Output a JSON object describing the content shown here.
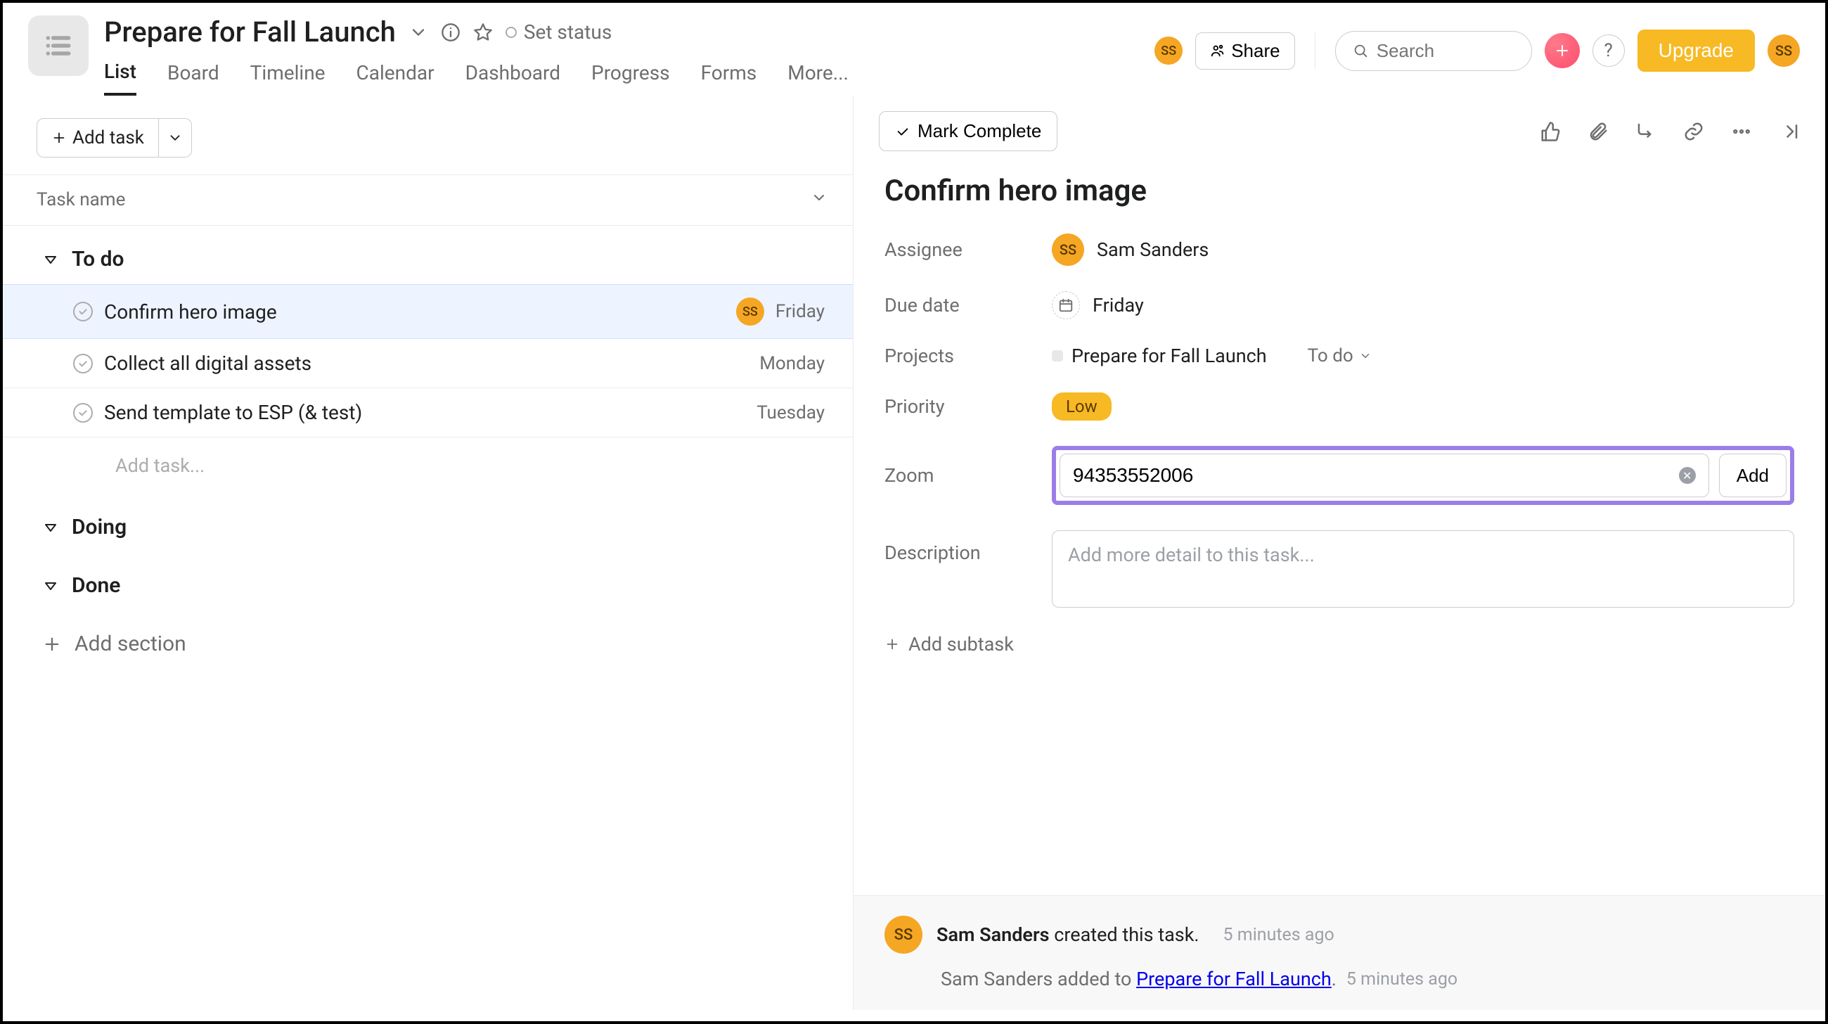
{
  "project": {
    "title": "Prepare for Fall Launch",
    "set_status": "Set status"
  },
  "tabs": [
    "List",
    "Board",
    "Timeline",
    "Calendar",
    "Dashboard",
    "Progress",
    "Forms",
    "More..."
  ],
  "active_tab": 0,
  "header": {
    "share": "Share",
    "search_placeholder": "Search",
    "upgrade": "Upgrade",
    "avatar_initials": "SS"
  },
  "toolbar": {
    "add_task": "Add task"
  },
  "list": {
    "header_label": "Task name",
    "sections": [
      {
        "name": "To do",
        "tasks": [
          {
            "name": "Confirm hero image",
            "assignee": "SS",
            "due": "Friday",
            "selected": true
          },
          {
            "name": "Collect all digital assets",
            "due": "Monday"
          },
          {
            "name": "Send template to ESP (& test)",
            "due": "Tuesday"
          }
        ],
        "add_inline": "Add task..."
      },
      {
        "name": "Doing",
        "tasks": []
      },
      {
        "name": "Done",
        "tasks": []
      }
    ],
    "add_section": "Add section"
  },
  "detail": {
    "mark_complete": "Mark Complete",
    "title": "Confirm hero image",
    "fields": {
      "assignee_label": "Assignee",
      "assignee_initials": "SS",
      "assignee_name": "Sam Sanders",
      "due_label": "Due date",
      "due_value": "Friday",
      "projects_label": "Projects",
      "project_name": "Prepare for Fall Launch",
      "project_section": "To do",
      "priority_label": "Priority",
      "priority_value": "Low",
      "zoom_label": "Zoom",
      "zoom_value": "94353552006",
      "zoom_add": "Add",
      "description_label": "Description",
      "description_placeholder": "Add more detail to this task..."
    },
    "add_subtask": "Add subtask",
    "activity": {
      "line1_user": "Sam Sanders",
      "line1_text": " created this task.",
      "line1_time": "5 minutes ago",
      "line2_user": "Sam Sanders",
      "line2_text": " added to ",
      "line2_link": "Prepare for Fall Launch",
      "line2_time": "5 minutes ago"
    }
  }
}
